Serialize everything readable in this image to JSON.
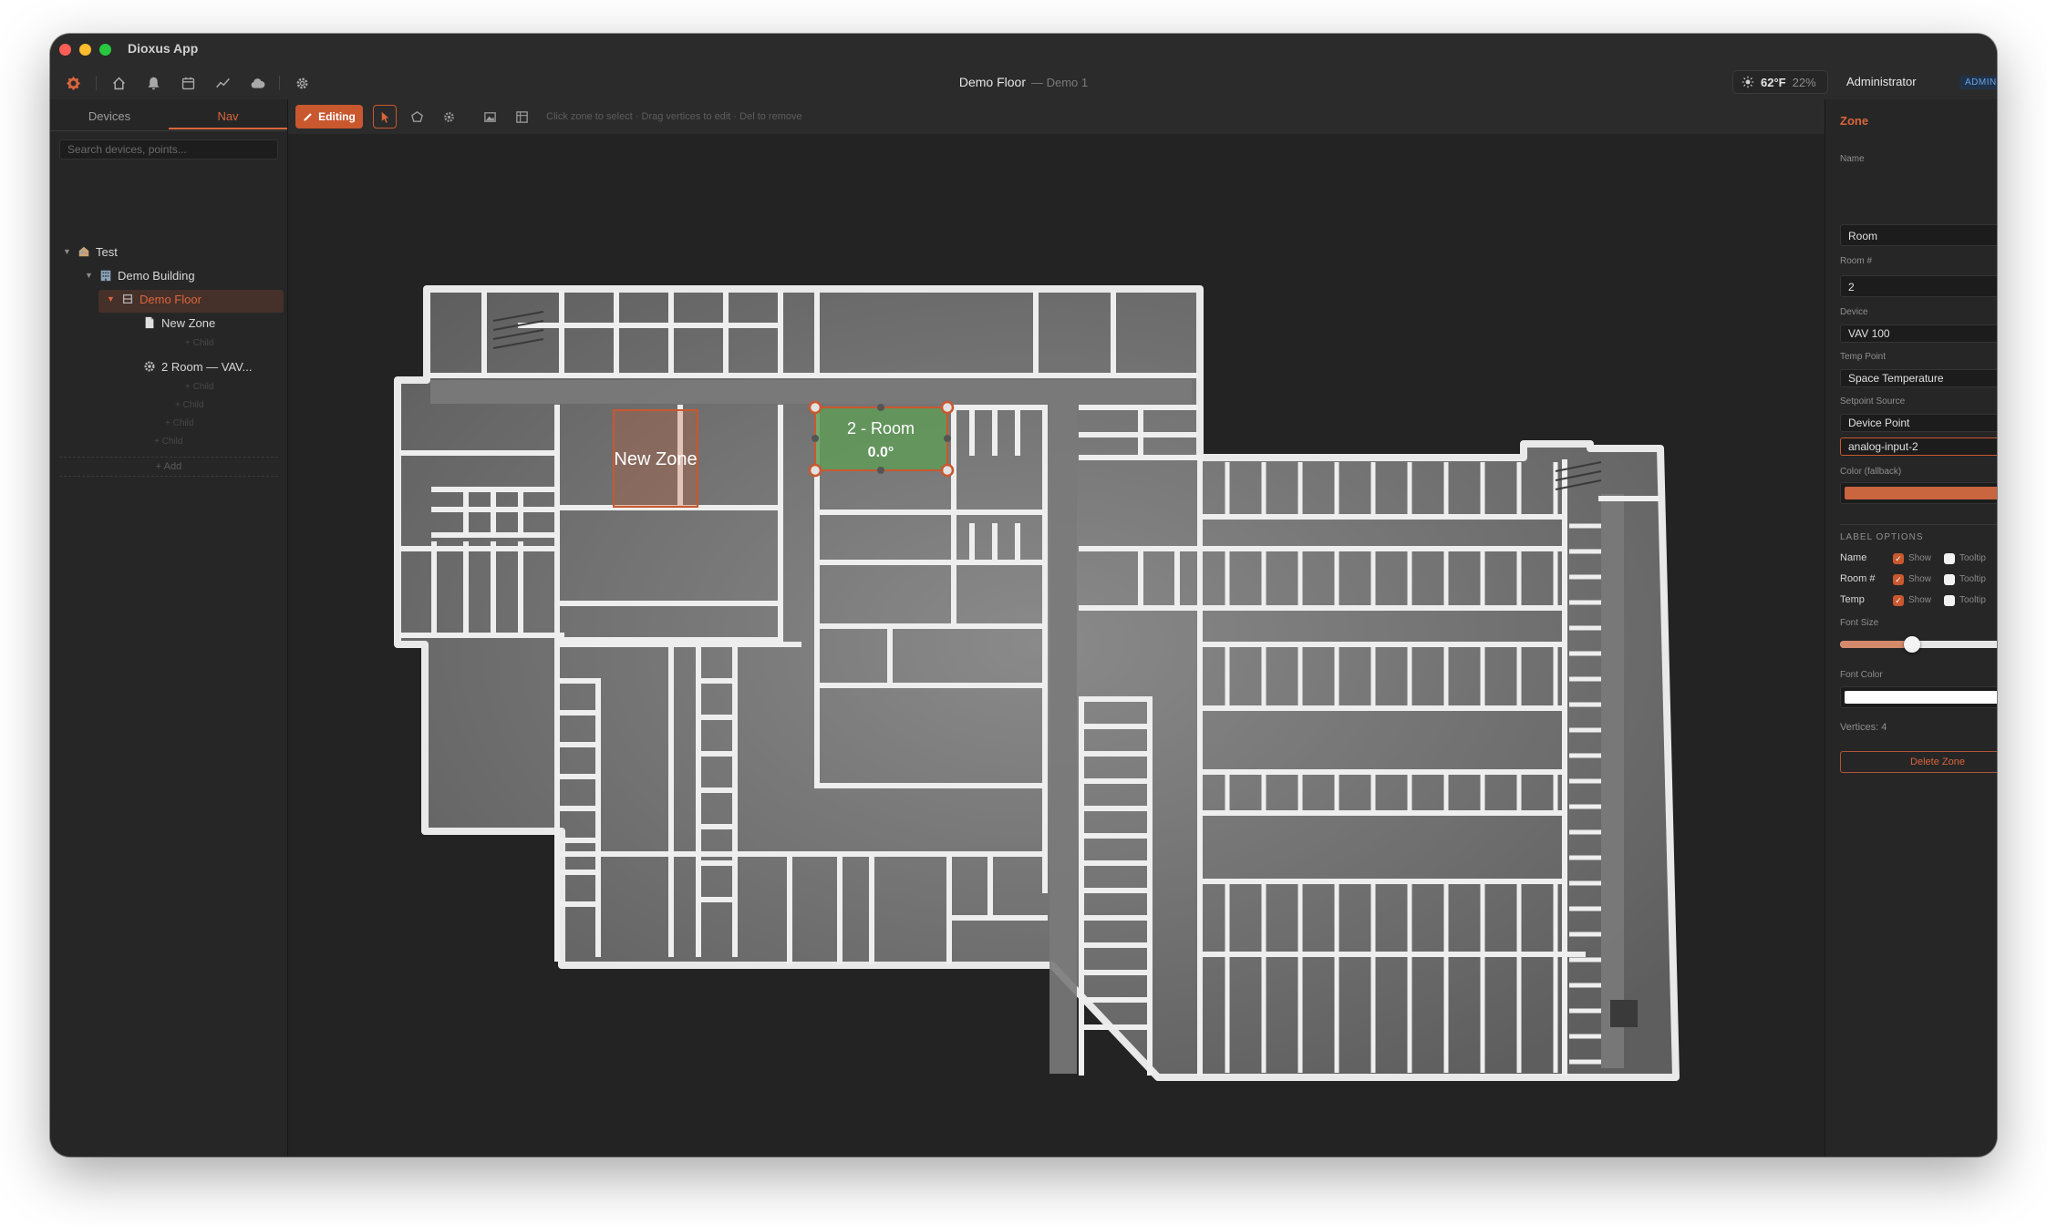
{
  "app": {
    "title": "Dioxus App"
  },
  "header": {
    "page_title": "Demo Floor",
    "page_subtitle": "— Demo 1",
    "weather": {
      "temp": "62°F",
      "humidity": "22%"
    },
    "user": "Administrator",
    "role_badge": "ADMIN"
  },
  "nav_icons": [
    "logo-icon",
    "home-icon",
    "bell-icon",
    "calendar-icon",
    "trend-icon",
    "cloud-icon",
    "gear-icon"
  ],
  "sidebar": {
    "tabs": [
      {
        "label": "Devices",
        "active": false
      },
      {
        "label": "Nav",
        "active": true
      }
    ],
    "search_placeholder": "Search devices, points...",
    "tree": [
      {
        "label": "Test",
        "level": 0,
        "icon": "site-icon"
      },
      {
        "label": "Demo Building",
        "level": 1,
        "icon": "building-icon"
      },
      {
        "label": "Demo Floor",
        "level": 2,
        "icon": "floor-icon",
        "selected": true
      },
      {
        "label": "New Zone",
        "level": 3,
        "icon": "document-icon"
      },
      {
        "label": "2 Room — VAV...",
        "level": 3,
        "icon": "device-icon"
      }
    ],
    "child_ghost": "+ Child",
    "add_label": "+ Add"
  },
  "toolbar": {
    "edit_label": "Editing",
    "hint": "Click zone to select · Drag vertices to edit · Del to remove"
  },
  "canvas": {
    "zones": [
      {
        "name": "New Zone",
        "selected": false,
        "color": "#c9582f"
      },
      {
        "name": "2 - Room",
        "temp": "0.0°",
        "selected": true,
        "color": "#5f9a58"
      }
    ]
  },
  "panel": {
    "title": "Zone",
    "name_label": "Name",
    "name_value": "Room",
    "room_label": "Room #",
    "room_value": "2",
    "device_label": "Device",
    "device_value": "VAV 100",
    "temp_point_label": "Temp Point",
    "temp_point_value": "Space Temperature",
    "setpoint_label": "Setpoint Source",
    "setpoint_value": "Device Point",
    "setpoint_point_value": "analog-input-2",
    "color_label": "Color (fallback)",
    "color_value": "#c9653f",
    "label_options_title": "LABEL OPTIONS",
    "label_options": [
      {
        "name": "Name",
        "show": "Show",
        "tooltip": "Tooltip"
      },
      {
        "name": "Room #",
        "show": "Show",
        "tooltip": "Tooltip"
      },
      {
        "name": "Temp",
        "show": "Show",
        "tooltip": "Tooltip"
      }
    ],
    "font_size_label": "Font Size",
    "font_size_fraction": 0.37,
    "font_color_label": "Font Color",
    "font_color_value": "#ffffff",
    "vertices_text": "Vertices: 4",
    "delete_label": "Delete Zone"
  }
}
